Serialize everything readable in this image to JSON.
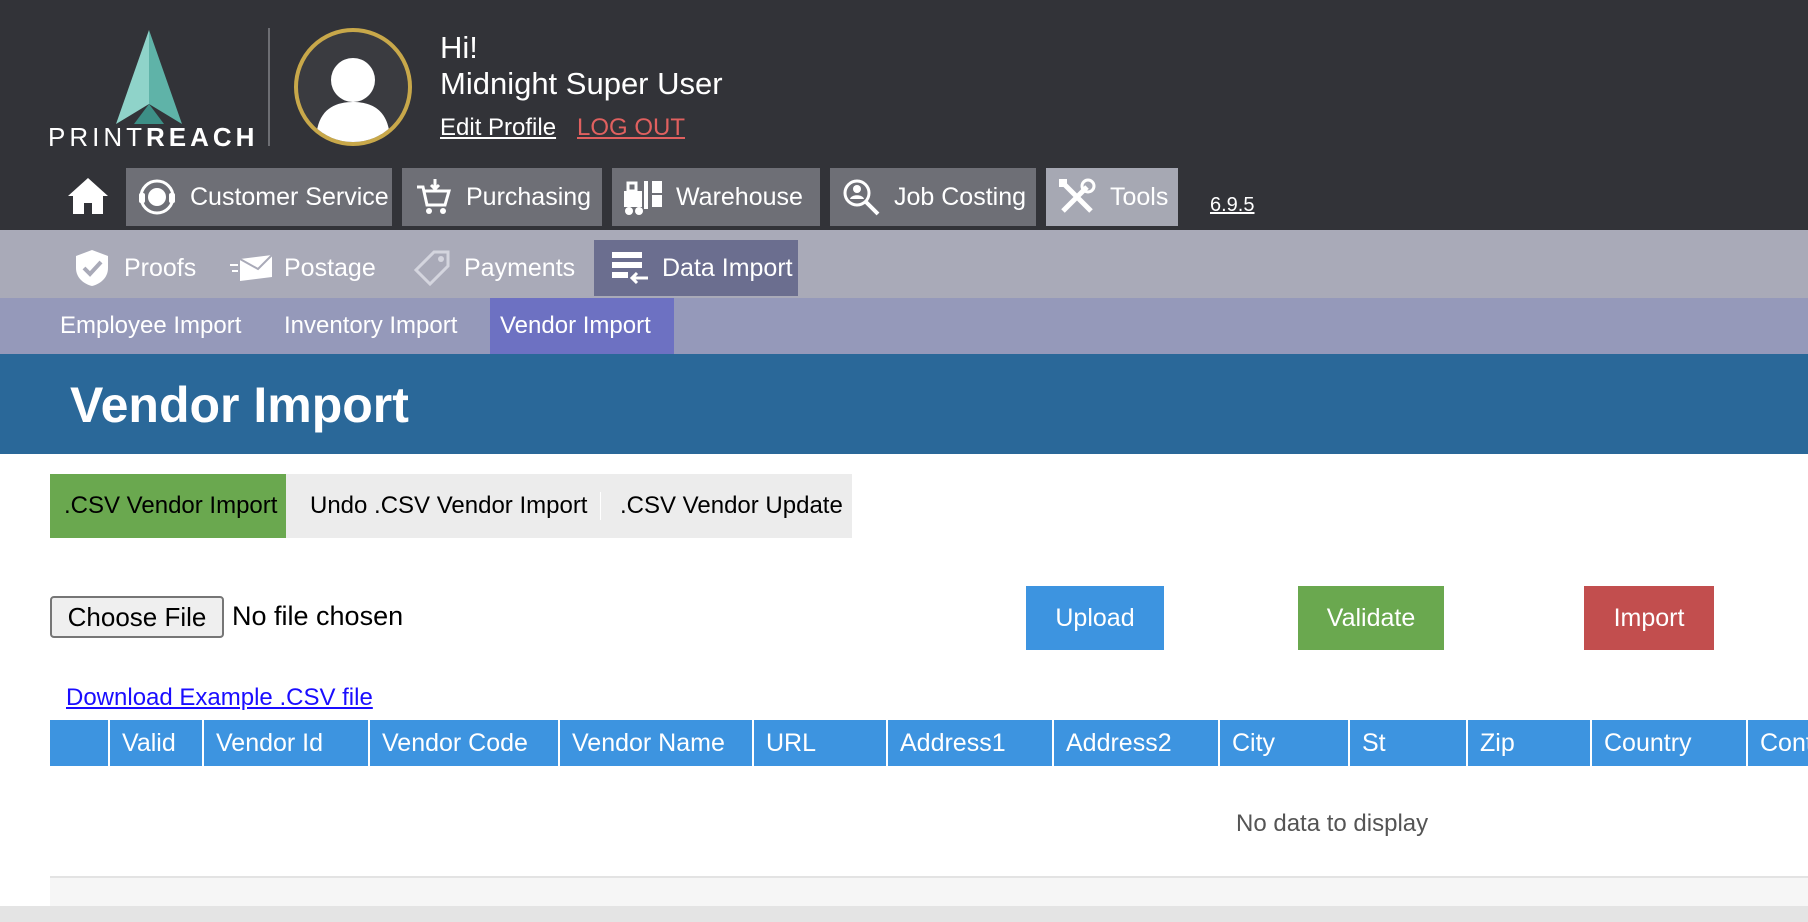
{
  "brand": {
    "logo_text_light": "PRINT",
    "logo_text_bold": "REACH"
  },
  "user": {
    "greeting": "Hi!",
    "name": "Midnight Super User",
    "edit_profile": "Edit Profile",
    "logout": "LOG OUT"
  },
  "mainnav": {
    "items": [
      {
        "label": "Customer Service",
        "icon": "headset-icon"
      },
      {
        "label": "Purchasing",
        "icon": "cart-icon"
      },
      {
        "label": "Warehouse",
        "icon": "forklift-icon"
      },
      {
        "label": "Job Costing",
        "icon": "magnifier-person-icon"
      },
      {
        "label": "Tools",
        "icon": "tools-icon",
        "active": true
      }
    ],
    "version": "6.9.5"
  },
  "subnav": {
    "items": [
      {
        "label": "Proofs",
        "icon": "shield-check-icon"
      },
      {
        "label": "Postage",
        "icon": "envelope-icon"
      },
      {
        "label": "Payments",
        "icon": "tag-icon"
      },
      {
        "label": "Data Import",
        "icon": "data-import-icon",
        "active": true
      }
    ]
  },
  "tertnav": {
    "items": [
      {
        "label": "Employee Import"
      },
      {
        "label": "Inventory Import"
      },
      {
        "label": "Vendor Import",
        "active": true
      }
    ]
  },
  "page": {
    "title": "Vendor Import"
  },
  "import_tabs": {
    "items": [
      {
        "label": ".CSV Vendor Import",
        "active": true
      },
      {
        "label": "Undo .CSV Vendor Import"
      },
      {
        "label": ".CSV Vendor Update"
      }
    ]
  },
  "file": {
    "choose_label": "Choose File",
    "status": "No file chosen"
  },
  "actions": {
    "upload": "Upload",
    "validate": "Validate",
    "import": "Import"
  },
  "download_link": "Download Example .CSV file",
  "grid": {
    "columns": [
      "",
      "Valid",
      "Vendor Id",
      "Vendor Code",
      "Vendor Name",
      "URL",
      "Address1",
      "Address2",
      "City",
      "St",
      "Zip",
      "Country",
      "Cont"
    ],
    "empty_text": "No data to display"
  },
  "colors": {
    "header_bg": "#323338",
    "subnav_bg": "#a9aab8",
    "tertnav_bg": "#9599ba",
    "title_bg": "#2a6899",
    "accent_blue": "#3d94e0",
    "accent_green": "#6aa84f",
    "accent_red": "#c24e4e",
    "logout_red": "#e0605f"
  }
}
